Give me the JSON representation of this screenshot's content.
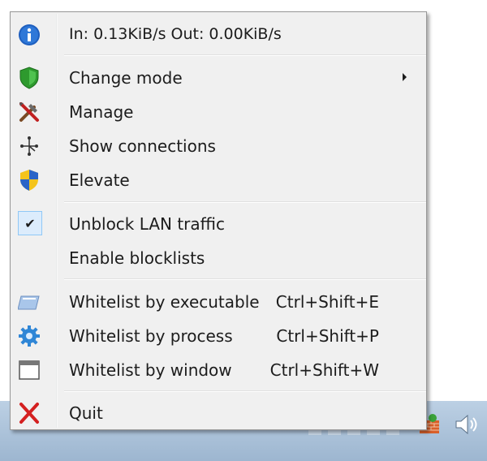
{
  "menu": {
    "status": "In: 0.13KiB/s   Out: 0.00KiB/s",
    "items": [
      {
        "label": "Change mode",
        "icon": "shield-icon",
        "has_submenu": true
      },
      {
        "label": "Manage",
        "icon": "tools-icon"
      },
      {
        "label": "Show connections",
        "icon": "network-icon"
      },
      {
        "label": "Elevate",
        "icon": "uac-shield-icon"
      },
      {
        "label": "Unblock LAN traffic",
        "checked": true
      },
      {
        "label": "Enable blocklists"
      },
      {
        "label": "Whitelist by executable",
        "shortcut": "Ctrl+Shift+E",
        "icon": "executable-icon"
      },
      {
        "label": "Whitelist by process",
        "shortcut": "Ctrl+Shift+P",
        "icon": "gear-icon"
      },
      {
        "label": "Whitelist by window",
        "shortcut": "Ctrl+Shift+W",
        "icon": "window-icon"
      },
      {
        "label": "Quit",
        "icon": "red-x-icon"
      }
    ]
  },
  "colors": {
    "info_blue": "#1e5fbf",
    "shield_green": "#2e9a2e",
    "quit_red": "#d42020",
    "check_highlight": "#dcecfc"
  }
}
